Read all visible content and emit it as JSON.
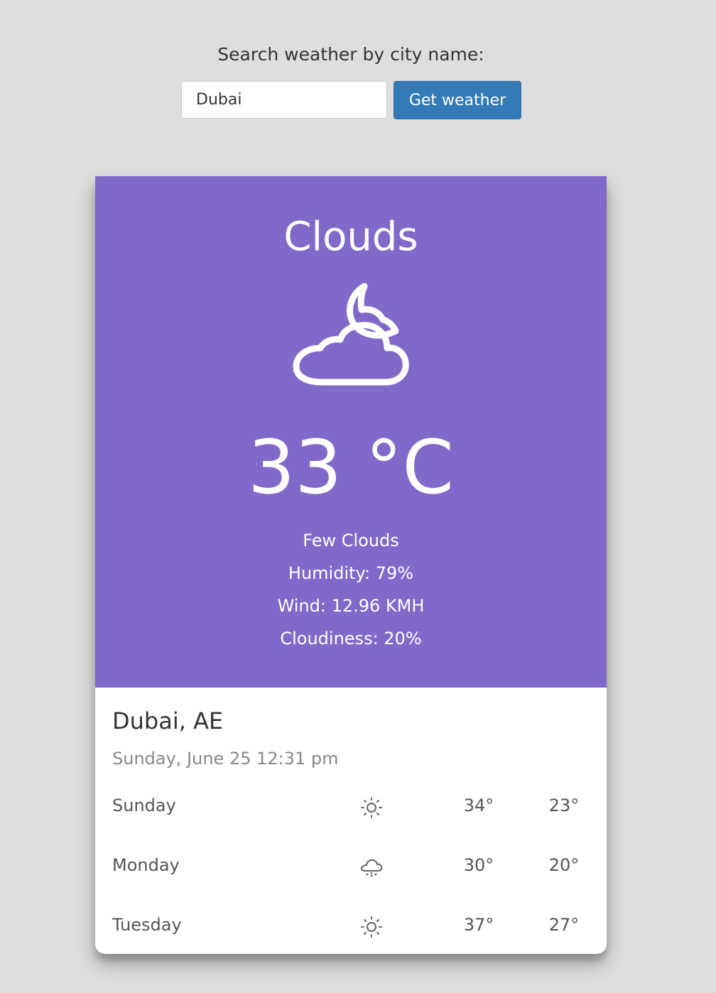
{
  "search": {
    "label": "Search weather by city name:",
    "value": "Dubai",
    "button_label": "Get weather"
  },
  "current": {
    "condition": "Clouds",
    "icon": "cloud-moon-icon",
    "temperature": "33 °C",
    "description": "Few Clouds",
    "humidity": "Humidity: 79%",
    "wind": "Wind: 12.96 KMH",
    "cloudiness": "Cloudiness: 20%"
  },
  "location": "Dubai, AE",
  "datetime": "Sunday, June 25 12:31 pm",
  "forecast": [
    {
      "day": "Sunday",
      "icon": "sun-icon",
      "high": "34°",
      "low": "23°"
    },
    {
      "day": "Monday",
      "icon": "rain-cloud-icon",
      "high": "30°",
      "low": "20°"
    },
    {
      "day": "Tuesday",
      "icon": "sun-icon",
      "high": "37°",
      "low": "27°"
    }
  ],
  "colors": {
    "page_background": "#dedede",
    "card_top": "#8069c9",
    "button": "#337ab7"
  }
}
